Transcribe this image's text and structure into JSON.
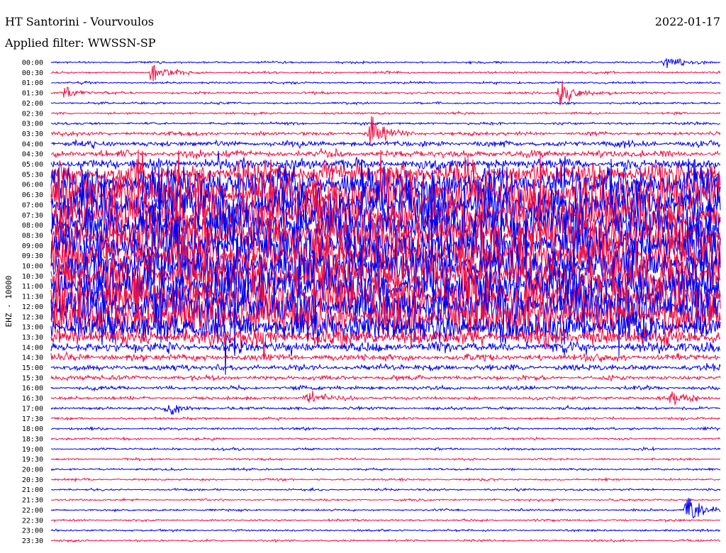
{
  "header": {
    "title": "HT Santorini - Vourvoulos",
    "date": "2022-01-17",
    "filter": "Applied filter: WWSSN-SP"
  },
  "colors": {
    "trace_a": "#0000ee",
    "trace_b": "#ee1144",
    "background": "#ffffff",
    "text": "#000000"
  },
  "chart_data": {
    "type": "helicorder",
    "ylabel": "EHZ - 10000",
    "row_labels": [
      "00:00",
      "00:30",
      "01:00",
      "01:30",
      "02:00",
      "02:30",
      "03:00",
      "03:30",
      "04:00",
      "04:30",
      "05:00",
      "05:30",
      "06:00",
      "06:30",
      "07:00",
      "07:30",
      "08:00",
      "08:30",
      "09:00",
      "09:30",
      "10:00",
      "10:30",
      "11:00",
      "11:30",
      "12:00",
      "12:30",
      "13:00",
      "13:30",
      "14:00",
      "14:30",
      "15:00",
      "15:30",
      "16:00",
      "16:30",
      "17:00",
      "17:30",
      "18:00",
      "18:30",
      "19:00",
      "19:30",
      "20:00",
      "20:30",
      "21:00",
      "21:30",
      "22:00",
      "22:30",
      "23:00",
      "23:30"
    ],
    "row_colors": [
      "blue",
      "red"
    ],
    "activity_level": [
      0.06,
      0.06,
      0.05,
      0.07,
      0.05,
      0.05,
      0.1,
      0.2,
      0.3,
      0.35,
      0.45,
      0.7,
      0.9,
      1.0,
      1.0,
      1.0,
      1.0,
      1.0,
      1.0,
      1.0,
      1.0,
      1.0,
      1.0,
      1.0,
      1.0,
      0.95,
      0.8,
      0.6,
      0.45,
      0.35,
      0.3,
      0.25,
      0.2,
      0.18,
      0.14,
      0.1,
      0.09,
      0.08,
      0.07,
      0.06,
      0.06,
      0.06,
      0.05,
      0.06,
      0.07,
      0.06,
      0.05,
      0.05
    ],
    "events": [
      {
        "row": 0,
        "minute": 27.5,
        "amp": 0.6
      },
      {
        "row": 1,
        "minute": 4.5,
        "amp": 0.9
      },
      {
        "row": 3,
        "minute": 0.6,
        "amp": 0.5
      },
      {
        "row": 3,
        "minute": 22.8,
        "amp": 1.4
      },
      {
        "row": 7,
        "minute": 14.3,
        "amp": 1.6
      },
      {
        "row": 15,
        "minute": 11.4,
        "amp": 1.5
      },
      {
        "row": 33,
        "minute": 11.4,
        "amp": 0.9
      },
      {
        "row": 33,
        "minute": 27.8,
        "amp": 0.9
      },
      {
        "row": 34,
        "minute": 5.2,
        "amp": 0.7
      },
      {
        "row": 44,
        "minute": 28.5,
        "amp": 1.8
      }
    ]
  }
}
